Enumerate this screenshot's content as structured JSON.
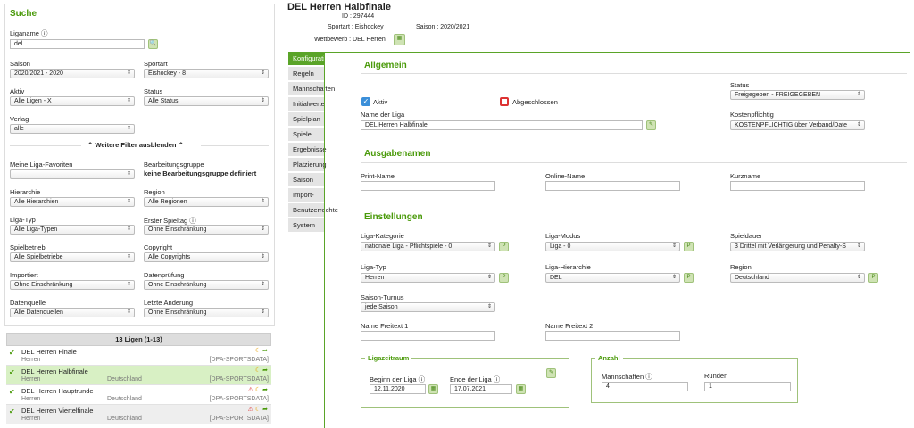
{
  "search": {
    "title": "Suche",
    "liganame_label": "Liganame ⓘ",
    "liganame_value": "del",
    "saison_label": "Saison",
    "saison_value": "2020/2021 - 2020",
    "sportart_label": "Sportart",
    "sportart_value": "Eishockey - 8",
    "aktiv_label": "Aktiv",
    "aktiv_value": "Alle Ligen - X",
    "status_label": "Status",
    "status_value": "Alle Status",
    "verlag_label": "Verlag",
    "verlag_value": "alle",
    "more_filters": "Weitere Filter ausblenden",
    "fav_label": "Meine Liga-Favoriten",
    "fav_value": "",
    "bgruppe_label": "Bearbeitungsgruppe",
    "bgruppe_value": "keine Bearbeitungsgruppe definiert",
    "hier_label": "Hierarchie",
    "hier_value": "Alle Hierarchien",
    "region_label": "Region",
    "region_value": "Alle Regionen",
    "ligatyp_label": "Liga-Typ",
    "ligatyp_value": "Alle Liga-Typen",
    "spieltag_label": "Erster Spieltag ⓘ",
    "spieltag_value": "Ohne Einschränkung",
    "spielbetrieb_label": "Spielbetrieb",
    "spielbetrieb_value": "Alle Spielbetriebe",
    "copyright_label": "Copyright",
    "copyright_value": "Alle Copyrights",
    "importiert_label": "Importiert",
    "importiert_value": "Ohne Einschränkung",
    "pruefung_label": "Datenprüfung",
    "pruefung_value": "Ohne Einschränkung",
    "quelle_label": "Datenquelle",
    "quelle_value": "Alle Datenquellen",
    "aenderung_label": "Letzte Änderung",
    "aenderung_value": "Ohne Einschränkung"
  },
  "results": {
    "header": "13 Ligen (1-13)",
    "rows": [
      {
        "name": "DEL Herren Finale",
        "sub": "Herren",
        "country": "",
        "source": "[DPA-SPORTSDATA]"
      },
      {
        "name": "DEL Herren Halbfinale",
        "sub": "Herren",
        "country": "Deutschland",
        "source": "[DPA-SPORTSDATA]"
      },
      {
        "name": "DEL Herren Hauptrunde",
        "sub": "Herren",
        "country": "Deutschland",
        "source": "[DPA-SPORTSDATA]"
      },
      {
        "name": "DEL Herren Viertelfinale",
        "sub": "Herren",
        "country": "Deutschland",
        "source": "[DPA-SPORTSDATA]"
      }
    ]
  },
  "detail": {
    "title": "DEL Herren Halbfinale",
    "id_text": "ID : 297444",
    "sportart_text": "Sportart : Eishockey",
    "saison_text": "Saison : 2020/2021",
    "wettbewerb_text": "Wettbewerb : DEL Herren"
  },
  "nav": [
    "Konfiguration",
    "Regeln",
    "Mannschaften",
    "Initialwerte",
    "Spielplan",
    "Spiele",
    "Ergebnisse",
    "Platzierung",
    "Saison",
    "Import-Log",
    "Benutzerrechte",
    "System"
  ],
  "allgemein": {
    "title": "Allgemein",
    "status_label": "Status",
    "status_value": "Freigegeben - FREIGEGEBEN",
    "aktiv_label": "Aktiv",
    "abgeschlossen_label": "Abgeschlossen",
    "name_label": "Name der Liga",
    "name_value": "DEL Herren Halbfinale",
    "kosten_label": "Kostenpflichtig",
    "kosten_value": "KOSTENPFLICHTIG über Verband/Date"
  },
  "ausgabe": {
    "title": "Ausgabenamen",
    "print_label": "Print-Name",
    "online_label": "Online-Name",
    "kurz_label": "Kurzname"
  },
  "einst": {
    "title": "Einstellungen",
    "kat_label": "Liga-Kategorie",
    "kat_value": "nationale Liga - Pflichtspiele - 0",
    "modus_label": "Liga-Modus",
    "modus_value": "Liga - 0",
    "dauer_label": "Spieldauer",
    "dauer_value": "3 Drittel mit Verlängerung und Penalty-S",
    "typ_label": "Liga-Typ",
    "typ_value": "Herren",
    "hier_label": "Liga-Hierarchie",
    "hier_value": "DEL",
    "region_label": "Region",
    "region_value": "Deutschland",
    "turnus_label": "Saison-Turnus",
    "turnus_value": "jede Saison",
    "frei1_label": "Name Freitext 1",
    "frei2_label": "Name Freitext 2"
  },
  "zeitraum": {
    "title": "Ligazeitraum",
    "beginn_label": "Beginn der Liga ⓘ",
    "beginn_value": "12.11.2020",
    "ende_label": "Ende der Liga ⓘ",
    "ende_value": "17.07.2021"
  },
  "anzahl": {
    "title": "Anzahl",
    "mann_label": "Mannschaften ⓘ",
    "mann_value": "4",
    "runden_label": "Runden",
    "runden_value": "1"
  }
}
